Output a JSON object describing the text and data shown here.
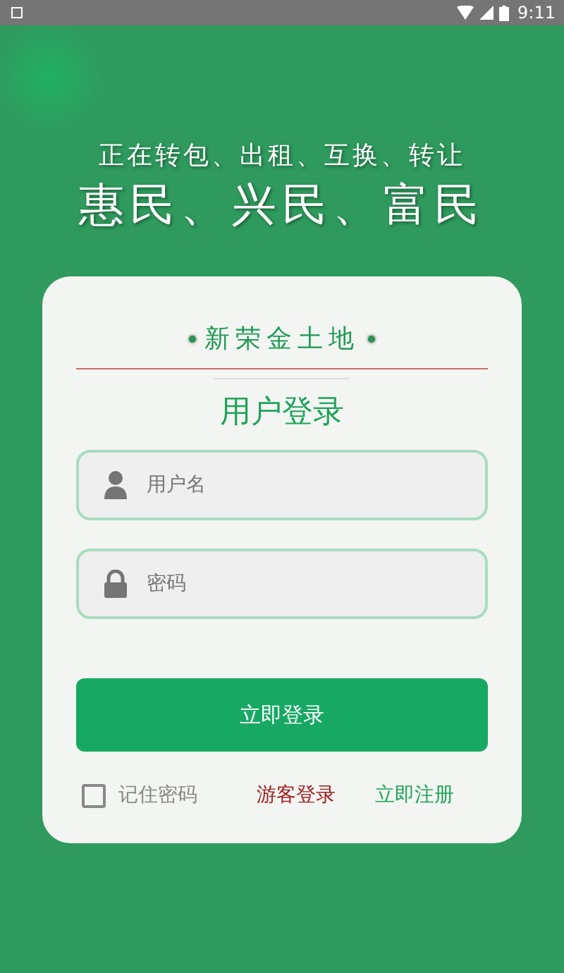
{
  "status_bar": {
    "time": "9:11"
  },
  "slogan": {
    "line_1": "正在转包、出租、互换、转让",
    "line_2": "惠民、兴民、富民"
  },
  "card": {
    "brand": "新荣金土地",
    "title": "用户登录",
    "fields": [
      {
        "kind": "user",
        "placeholder": "用户名"
      },
      {
        "kind": "lock",
        "placeholder": "密码"
      }
    ],
    "login_button": "立即登录",
    "remember": {
      "label": "记住密码",
      "checked": false
    },
    "guest_link": "游客登录",
    "register_link": "立即注册"
  }
}
